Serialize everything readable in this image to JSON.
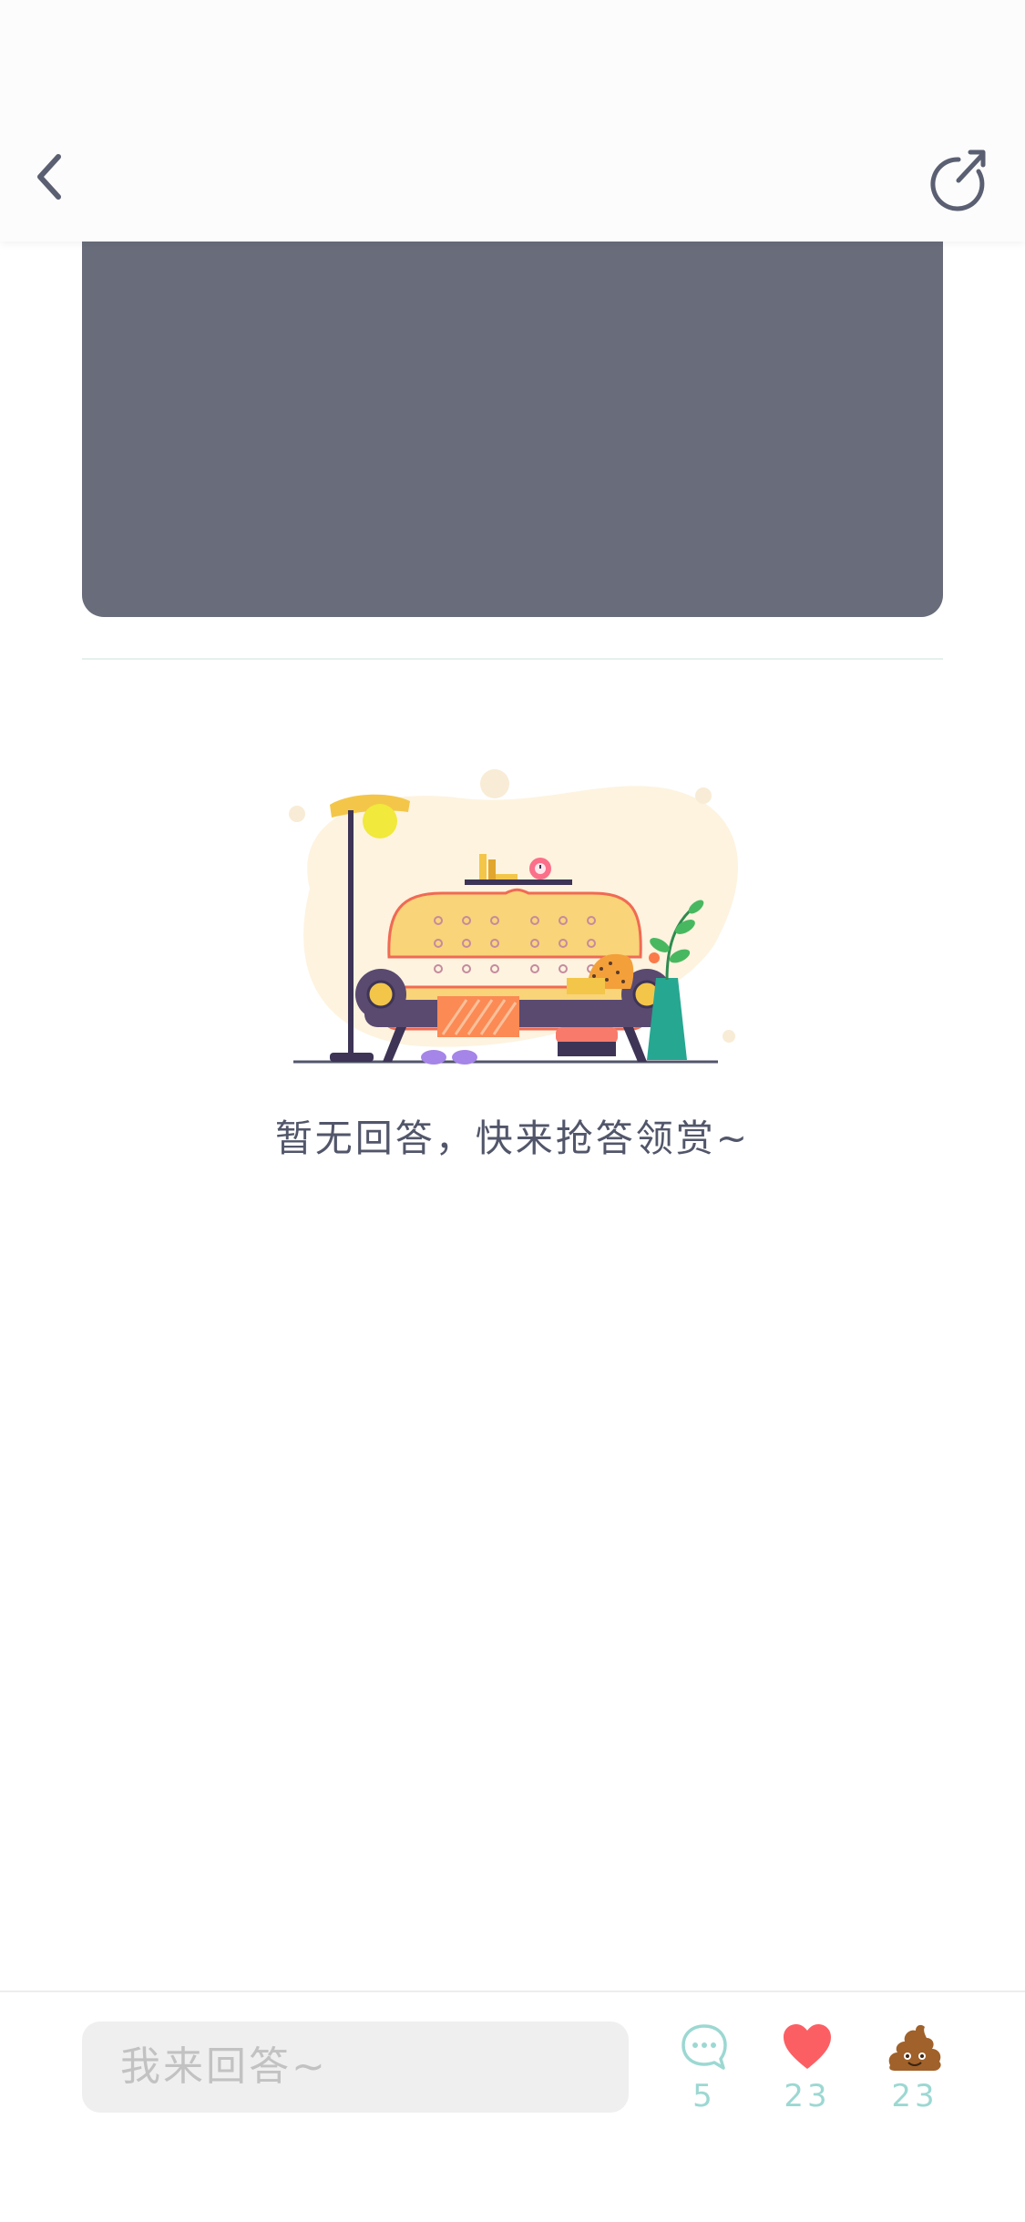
{
  "empty_state": {
    "message": "暂无回答，快来抢答领赏~"
  },
  "bottom_bar": {
    "answer_placeholder": "我来回答~",
    "comments_count": "5",
    "likes_count": "23",
    "poop_count": "23"
  },
  "icons": {
    "back": "chevron-left-icon",
    "refresh": "refresh-icon",
    "comment": "speech-bubble-icon",
    "like": "heart-icon",
    "poop": "poop-icon"
  },
  "colors": {
    "header_icon": "#5b5f72",
    "card_gray": "#696c7b",
    "accent_teal": "#9cd8d2",
    "heart_red": "#fb5f64",
    "poop_brown": "#a0612a"
  }
}
